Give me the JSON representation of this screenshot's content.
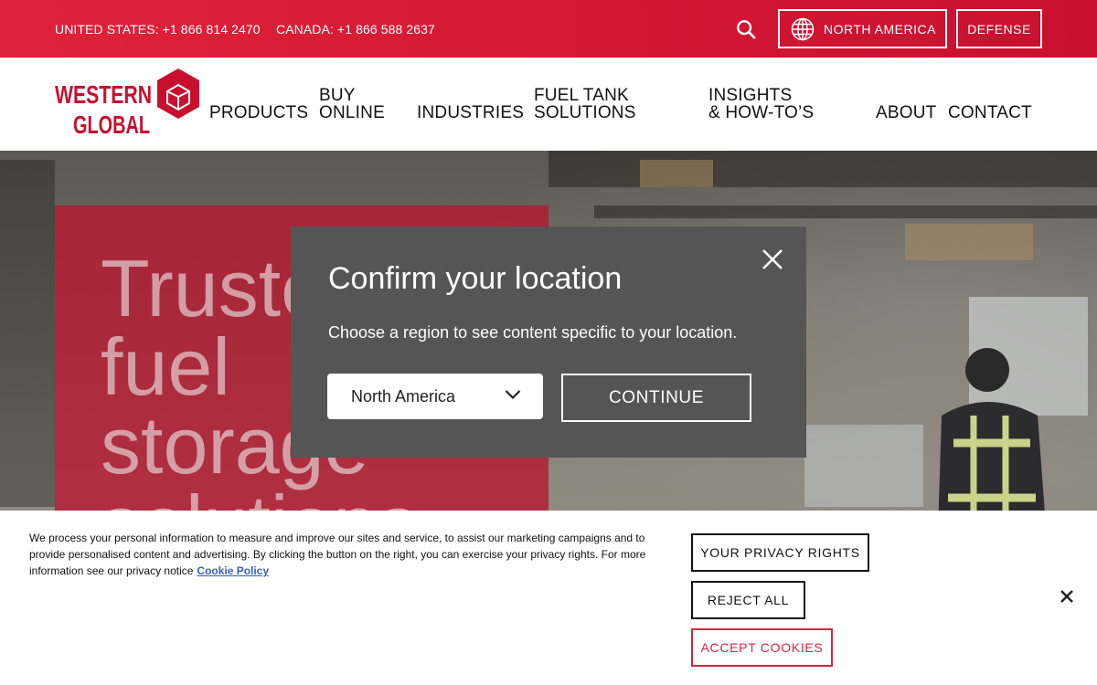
{
  "topbar": {
    "phone_us": "UNITED STATES: +1 866 814 2470",
    "phone_ca": "CANADA: +1 866 588 2637",
    "region_label": "NORTH AMERICA",
    "defense_label": "DEFENSE",
    "search_icon": "search-icon",
    "globe_icon": "globe-icon"
  },
  "brand": {
    "line1": "WESTERN",
    "line2": "GLOBAL",
    "color": "#c8102e"
  },
  "nav": {
    "products": "PRODUCTS",
    "buy_online_l1": "BUY",
    "buy_online_l2": "ONLINE",
    "industries": "INDUSTRIES",
    "fuel_tank_l1": "FUEL TANK",
    "fuel_tank_l2": "SOLUTIONS",
    "insights_l1": "INSIGHTS",
    "insights_l2": "& HOW-TO’S",
    "about": "ABOUT",
    "contact": "CONTACT"
  },
  "hero": {
    "headline": "Trusted\nfuel\nstorage\nsolutions"
  },
  "modal": {
    "title": "Confirm your location",
    "description": "Choose a region to see content specific to your location.",
    "selected_region": "North America",
    "continue_label": "CONTINUE",
    "bg_color": "#555555"
  },
  "cookie": {
    "text": "We process your personal information to measure and improve our sites and service, to assist our marketing campaigns and to provide personalised content and advertising. By clicking the button on the right, you can exercise your privacy rights. For more information see our privacy notice",
    "link_label": "Cookie Policy",
    "privacy_label": "YOUR PRIVACY RIGHTS",
    "reject_label": "REJECT ALL",
    "accept_label": "ACCEPT COOKIES",
    "accent_color": "#d9223e"
  }
}
